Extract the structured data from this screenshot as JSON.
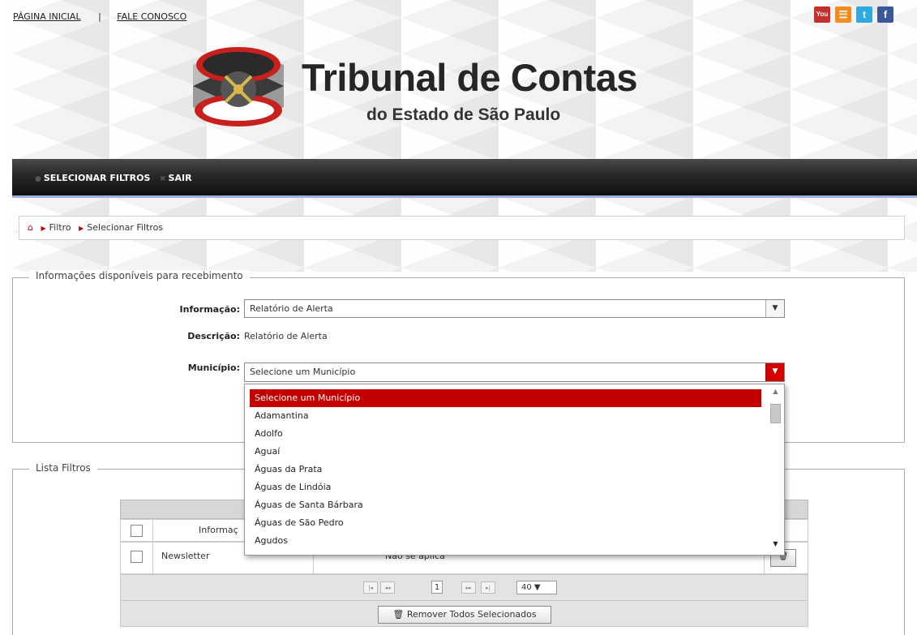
{
  "header": {
    "links": [
      "PÁGINA INICIAL",
      "FALE CONOSCO"
    ],
    "separator": "|",
    "title": "Tribunal de Contas",
    "subtitle": "do Estado de São Paulo",
    "social": [
      {
        "name": "youtube-icon",
        "glyph": "You"
      },
      {
        "name": "rss-icon",
        "glyph": "☰"
      },
      {
        "name": "twitter-icon",
        "glyph": "t"
      },
      {
        "name": "facebook-icon",
        "glyph": "f"
      }
    ]
  },
  "nav": {
    "items": [
      "SELECIONAR FILTROS",
      "SAIR"
    ]
  },
  "breadcrumb": {
    "items": [
      "Filtro",
      "Selecionar Filtros"
    ]
  },
  "form": {
    "legend": "Informações disponíveis para recebimento",
    "informacao_label": "Informação:",
    "informacao_value": "Relatório de Alerta",
    "descricao_label": "Descrição:",
    "descricao_value": "Relatório de Alerta",
    "municipio_label": "Município:",
    "municipio_value": "Selecione um Município"
  },
  "dropdown": {
    "options": [
      "Selecione um Município",
      "Adamantina",
      "Adolfo",
      "Aguaí",
      "Águas da Prata",
      "Águas de Lindóia",
      "Águas de Santa Bárbara",
      "Águas de São Pedro",
      "Agudos"
    ],
    "selected_index": 0
  },
  "filters": {
    "legend": "Lista Filtros",
    "column_informacao": "Informaç",
    "rows": [
      {
        "informacao": "Newsletter",
        "municipio": "Não se aplica"
      }
    ],
    "pager": {
      "first": "|◂",
      "prev": "◂◂",
      "page": "1",
      "next": "▸▸",
      "last": "▸|",
      "page_size": "40 ▼"
    },
    "remove_all_label": "Remover Todos Selecionados"
  },
  "colors": {
    "accent_red": "#c40000",
    "nav_dark": "#1a1a1a",
    "nav_underline": "#9bb0e0"
  }
}
